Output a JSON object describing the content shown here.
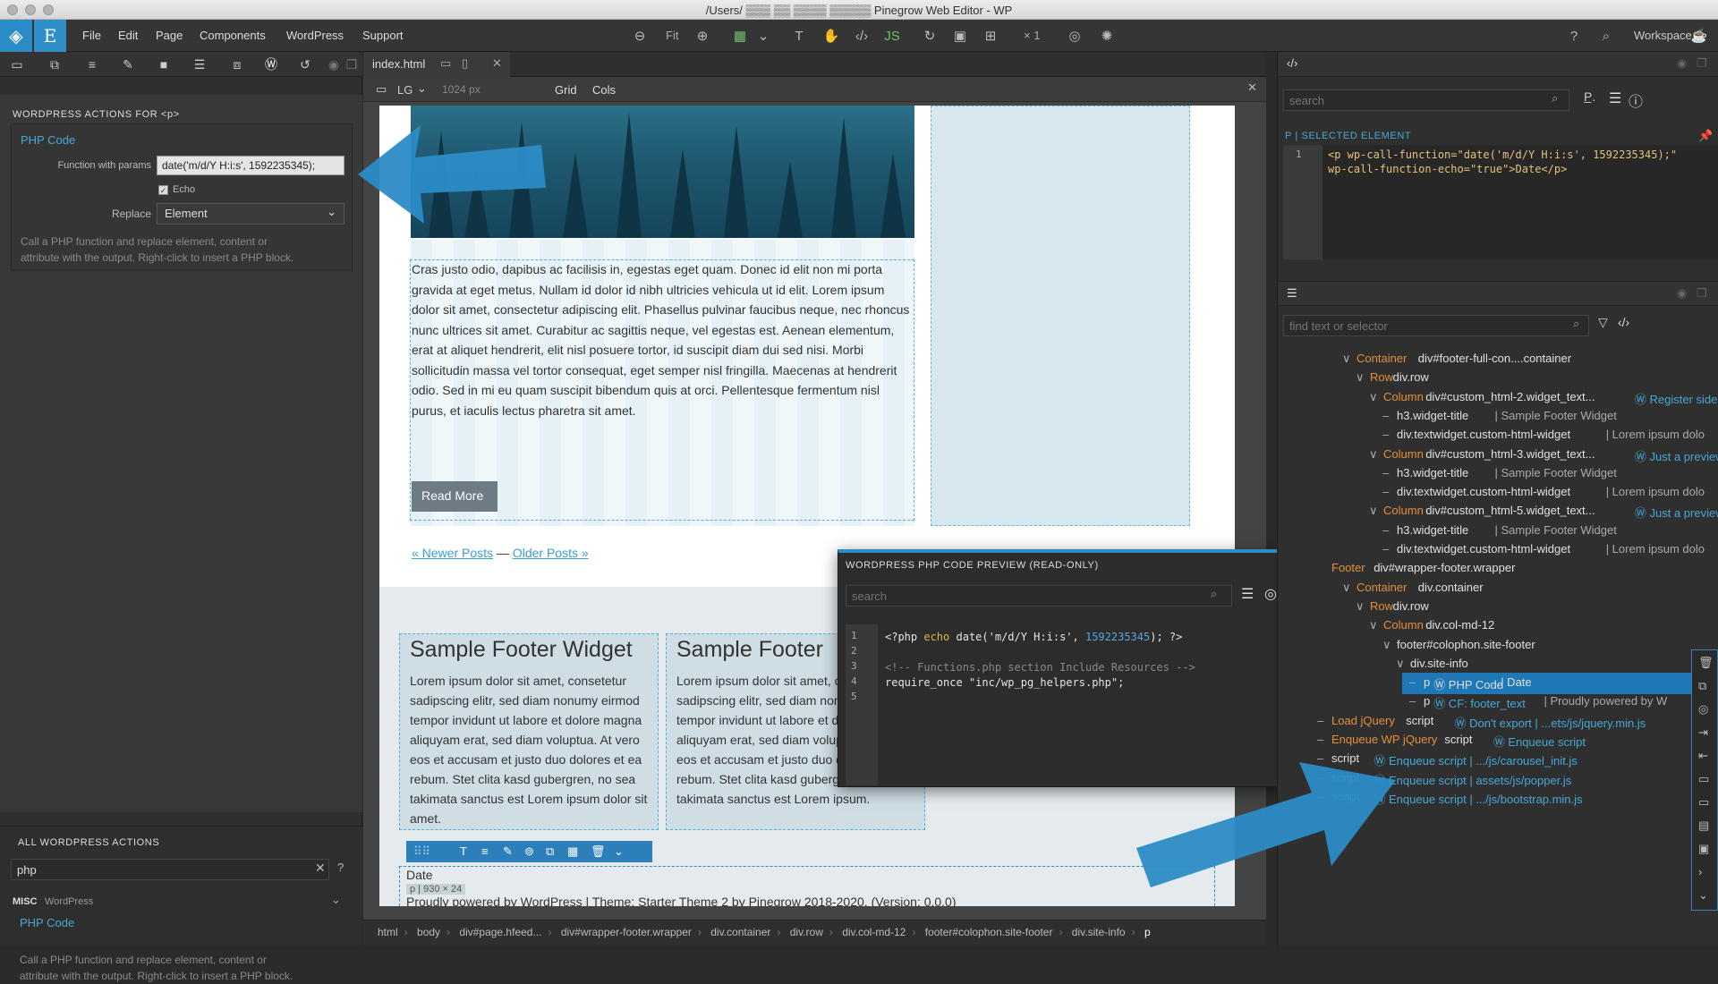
{
  "window": {
    "title": "/Users/ ▒▒▒ ▒▒ ▒▒▒▒ ▒▒▒▒▒ Pinegrow Web Editor - WP"
  },
  "menu": {
    "items": [
      "File",
      "Edit",
      "Page",
      "Components",
      "WordPress",
      "Support"
    ],
    "fit_label": "Fit",
    "zoom_label": "× 1",
    "workspace_label": "Workspace"
  },
  "left_panel": {
    "actions_heading": "WORDPRESS ACTIONS FOR <p>",
    "action_title": "PHP Code",
    "function_label": "Function with params",
    "function_value": "date('m/d/Y H:i:s', 1592235345);",
    "echo_label": "Echo",
    "echo_checked": true,
    "replace_label": "Replace",
    "replace_value": "Element",
    "action_desc_1": "Call a PHP function and replace element, content or",
    "action_desc_2": "attribute with the output. Right-click to insert a PHP block.",
    "all_actions_heading": "ALL WORDPRESS ACTIONS",
    "search_value": "php",
    "misc_label": "MISC",
    "misc_sub": "WordPress",
    "list_item_title": "PHP Code",
    "list_item_desc_1": "Call a PHP function and replace element, content or",
    "list_item_desc_2": "attribute with the output. Right-click to insert a PHP block."
  },
  "center": {
    "tab_label": "index.html",
    "device_label": "LG",
    "width_label": "1024 px",
    "grid_label": "Grid",
    "cols_label": "Cols",
    "article_text": "Cras justo odio, dapibus ac facilisis in, egestas eget quam. Donec id elit non mi porta gravida at eget metus. Nullam id dolor id nibh ultricies vehicula ut id elit. Lorem ipsum dolor sit amet, consectetur adipiscing elit. Phasellus pulvinar faucibus neque, nec rhoncus nunc ultrices sit amet. Curabitur ac sagittis neque, vel egestas est. Aenean elementum, erat at aliquet hendrerit, elit nisl posuere tortor, id suscipit diam dui sed nisi. Morbi sollicitudin massa vel tortor consequat, eget semper nisl fringilla. Maecenas at hendrerit odio. Sed in mi eu quam suscipit bibendum quis at orci. Pellentesque fermentum nisl purus, et iaculis lectus pharetra sit amet.",
    "read_more": "Read More",
    "newer_posts": "« Newer Posts",
    "pagination_sep": "—",
    "older_posts": "Older Posts »",
    "footer_widget_title": "Sample Footer Widget",
    "footer_widget_title_2": "Sample Footer",
    "footer_widget_text": "Lorem ipsum dolor sit amet, consetetur sadipscing elitr, sed diam nonumy eirmod tempor invidunt ut labore et dolore magna aliquyam erat, sed diam voluptua. At vero eos et accusam et justo duo dolores et ea rebum. Stet clita kasd gubergren, no sea takimata sanctus est Lorem ipsum dolor sit amet.",
    "footer_widget_text_2": "Lorem ipsum dolor sit amet, consetetur sadipscing elitr, sed diam nonumy eirmod tempor invidunt ut labore et dolore magna aliquyam erat, sed diam voluptua. At vero eos et accusam et justo duo dolores et ea rebum. Stet clita kasd gubergren, no sea takimata sanctus est Lorem ipsum.",
    "date_text": "Date",
    "element_size": "p | 930 × 24",
    "powered_text": "Proudly powered by WordPress | Theme: Starter Theme 2 by Pinegrow 2018-2020. (Version: 0.0.0)",
    "breadcrumbs": [
      "html",
      "body",
      "div#page.hfeed...",
      "div#wrapper-footer.wrapper",
      "div.container",
      "div.row",
      "div.col-md-12",
      "footer#colophon.site-footer",
      "div.site-info",
      "p"
    ]
  },
  "php_preview": {
    "heading": "WORDPRESS PHP CODE PREVIEW (READ-ONLY)",
    "search_placeholder": "search",
    "line_numbers": [
      "1",
      "2",
      "3",
      "4",
      "5"
    ],
    "line1_open": "<?php ",
    "line1_echo": "echo",
    "line1_call": " date('m/d/Y H:i:s', ",
    "line1_num": "1592235345",
    "line1_close": "); ?>",
    "line3": "<!-- Functions.php section Include Resources -->",
    "line4": "require_once \"inc/wp_pg_helpers.php\";"
  },
  "right_panel": {
    "search_placeholder": "search",
    "selected_label": "P | SELECTED ELEMENT",
    "code_line_number": "1",
    "code_line_1": "<p wp-call-function=\"date('m/d/Y H:i:s', 1592235345);\"",
    "code_line_2": "wp-call-function-echo=\"true\">Date</p>",
    "tree_search_placeholder": "find text or selector",
    "tree": [
      {
        "indent": 0,
        "arrow": "∨",
        "label": "Container",
        "sel": " div#footer-full-con....container",
        "extra": ""
      },
      {
        "indent": 1,
        "arrow": "∨",
        "label": "Row",
        "sel": " div.row",
        "extra": ""
      },
      {
        "indent": 2,
        "arrow": "∨",
        "label": "Column",
        "sel": " div#custom_html-2.widget_text...",
        "extra": "Register sidel"
      },
      {
        "indent": 3,
        "arrow": "–",
        "label": "",
        "sel": "h3.widget-title",
        "extra": "| Sample Footer Widget"
      },
      {
        "indent": 3,
        "arrow": "–",
        "label": "",
        "sel": "div.textwidget.custom-html-widget",
        "extra": "| Lorem ipsum dolo"
      },
      {
        "indent": 2,
        "arrow": "∨",
        "label": "Column",
        "sel": " div#custom_html-3.widget_text...",
        "extra": "Just a preview"
      },
      {
        "indent": 3,
        "arrow": "–",
        "label": "",
        "sel": "h3.widget-title",
        "extra": "| Sample Footer Widget"
      },
      {
        "indent": 3,
        "arrow": "–",
        "label": "",
        "sel": "div.textwidget.custom-html-widget",
        "extra": "| Lorem ipsum dolo"
      },
      {
        "indent": 2,
        "arrow": "∨",
        "label": "Column",
        "sel": " div#custom_html-5.widget_text...",
        "extra": "Just a preview"
      },
      {
        "indent": 3,
        "arrow": "–",
        "label": "",
        "sel": "h3.widget-title",
        "extra": "| Sample Footer Widget"
      },
      {
        "indent": 3,
        "arrow": "–",
        "label": "",
        "sel": "div.textwidget.custom-html-widget",
        "extra": "| Lorem ipsum dolo"
      },
      {
        "indent": -1,
        "arrow": "",
        "label": "Footer",
        "sel": " div#wrapper-footer.wrapper",
        "extra": ""
      },
      {
        "indent": 0,
        "arrow": "∨",
        "label": "Container",
        "sel": " div.container",
        "extra": ""
      },
      {
        "indent": 1,
        "arrow": "∨",
        "label": "Row",
        "sel": " div.row",
        "extra": ""
      },
      {
        "indent": 2,
        "arrow": "∨",
        "label": "Column",
        "sel": " div.col-md-12",
        "extra": ""
      },
      {
        "indent": 3,
        "arrow": "∨",
        "label": "",
        "sel": "footer#colophon.site-footer",
        "extra": ""
      },
      {
        "indent": 4,
        "arrow": "∨",
        "label": "",
        "sel": "div.site-info",
        "extra": ""
      },
      {
        "indent": 5,
        "arrow": "–",
        "label": "p",
        "sel": "PHP Code",
        "extra": "| Date",
        "selected": true
      },
      {
        "indent": 5,
        "arrow": "–",
        "label": "p",
        "sel": "CF: footer_text",
        "extra": "| Proudly powered by W"
      },
      {
        "indent": -1,
        "arrow": "–",
        "label": "Load jQuery",
        "sel": " script",
        "extra": "Don't export | ...ets/js/jquery.min.js"
      },
      {
        "indent": -1,
        "arrow": "–",
        "label": "Enqueue WP jQuery",
        "sel": " script",
        "extra": "Enqueue script"
      },
      {
        "indent": -1,
        "arrow": "–",
        "label": "",
        "sel": "script",
        "extra": "Enqueue script | .../js/carousel_init.js"
      },
      {
        "indent": -1,
        "arrow": "–",
        "label": "",
        "sel": "script",
        "extra": "Enqueue script | assets/js/popper.js"
      },
      {
        "indent": -1,
        "arrow": "–",
        "label": "",
        "sel": "script",
        "extra": "Enqueue script | .../js/bootstrap.min.js"
      }
    ]
  },
  "colors": {
    "accent": "#2c8cc7",
    "link": "#46a8d8",
    "orange": "#e48e3a",
    "selected_row": "#1d78b5"
  }
}
